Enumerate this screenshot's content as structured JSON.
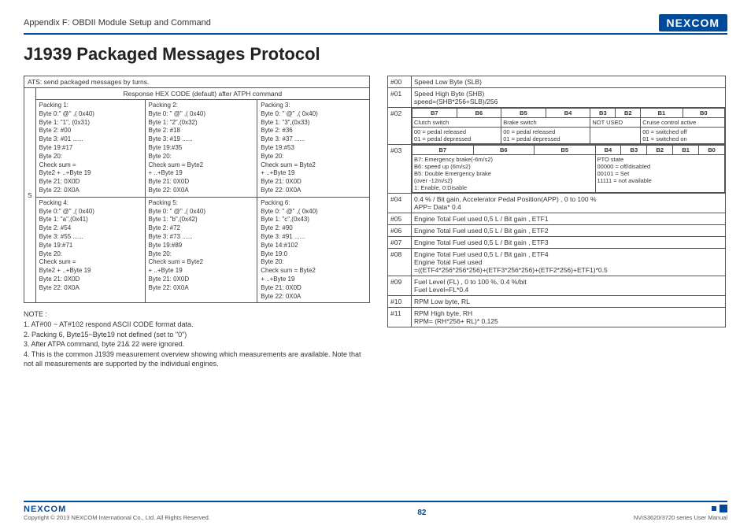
{
  "header": {
    "section": "Appendix F: OBDII Module Setup and Command",
    "logo": "NEXCOM"
  },
  "title": "J1939 Packaged Messages Protocol",
  "leftTable": {
    "atsHeader": "ATS: send packaged messages by turns.",
    "responseHeader": "Response HEX CODE (default) after ATPH command",
    "sLabel": "S",
    "packings": [
      "Packing 1:\nByte 0:\" @\" ,( 0x40)\nByte 1: \"1\", (0x31)\nByte 2: #00\nByte 3: #01 ......\nByte 19:#17\nByte 20:\nCheck sum =\nByte2 + ..+Byte 19\nByte 21: 0X0D\nByte 22: 0X0A",
      "Packing 2:\nByte 0: \" @\" ,( 0x40)\nByte 1: \"2\",(0x32)\nByte 2: #18\nByte 3: #19 ......\nByte 19:#35\nByte 20:\nCheck sum = Byte2\n+ ..+Byte 19\nByte 21: 0X0D\nByte 22: 0X0A",
      "Packing 3:\nByte 0: \" @\" ,( 0x40)\nByte 1: \"3\",(0x33)\nByte 2: #36\nByte 3: #37 ......\nByte 19:#53\nByte 20:\nCheck sum = Byte2\n+ ..+Byte 19\nByte 21: 0X0D\nByte 22: 0X0A",
      "Packing 4:\nByte 0:\" @\" ,( 0x40)\nByte 1: \"a\",(0x41)\nByte 2: #54\nByte 3: #55 ......\nByte 19:#71\nByte 20:\nCheck sum =\nByte2 + ..+Byte 19\nByte 21: 0X0D\nByte 22: 0X0A",
      "Packing 5:\nByte 0: \" @\" ,( 0x40)\nByte 1: \"b\",(0x42)\nByte 2: #72\nByte 3: #73 ......\nByte 19:#89\nByte 20:\nCheck sum = Byte2\n+ ..+Byte 19\nByte 21: 0X0D\nByte 22: 0X0A",
      "Packing 6:\nByte 0: \" @\" ,( 0x40)\nByte 1: \"c\",(0x43)\nByte 2: #90\nByte 3: #91 ......\nByte 14:#102\nByte 19:0\nByte 20:\nCheck sum = Byte2\n+ ..+Byte 19\nByte 21: 0X0D\nByte 22: 0X0A"
    ]
  },
  "notes": {
    "heading": "NOTE :",
    "n1": "1. AT#00 ~ AT#102 respond ASCII CODE format data.",
    "n2": "2. Packing 6, Byte15~Byte19 not defined (set to \"0\")",
    "n3": "3. After ATPA command, byte 21& 22 were ignored.",
    "n4": "4. This is the common J1939 measurement overview showing which measurements are available. Note that not all measurements are supported by the individual engines."
  },
  "right": {
    "r00": {
      "id": "#00",
      "text": "Speed Low Byte (SLB)"
    },
    "r01": {
      "id": "#01",
      "text": "Speed High Byte (SHB)\nspeed=(SHB*256+SLB)/256"
    },
    "r02": {
      "id": "#02",
      "bits": [
        "B7",
        "B6",
        "B5",
        "B4",
        "B3",
        "B2",
        "B1",
        "B0"
      ],
      "c1": "Clutch switch",
      "c2": "Brake switch",
      "c3": "NOT USED",
      "c4": "Cruise control active",
      "d1": "00 = pedal released\n01 = pedal depressed",
      "d2": "00 = pedal released\n01 = pedal depressed",
      "d3": "",
      "d4": "00 = switched off\n01 = switched on"
    },
    "r03": {
      "id": "#03",
      "bits": [
        "B7",
        "B6",
        "B5",
        "B4",
        "B3",
        "B2",
        "B1",
        "B0"
      ],
      "left": "B7: Emergency brake(-6m/s2)\nB6: speed up (6m/s2)\nB5: Double Emergency brake\n(over -12m/s2)\n1: Enable, 0:Disable",
      "right": "PTO state\n00000 = off/disabled\n00101 = Set\n11111 = not available"
    },
    "r04": {
      "id": "#04",
      "text": "0.4 % / Bit gain, Accelerator Pedal Position(APP) , 0 to 100 %\nAPP= Data* 0.4"
    },
    "r05": {
      "id": "#05",
      "text": "Engine Total Fuel used 0,5 L / Bit gain , ETF1"
    },
    "r06": {
      "id": "#06",
      "text": "Engine Total Fuel used 0,5 L / Bit gain , ETF2"
    },
    "r07": {
      "id": "#07",
      "text": "Engine Total Fuel used 0,5 L / Bit gain , ETF3"
    },
    "r08": {
      "id": "#08",
      "text": "Engine Total Fuel used 0,5 L / Bit gain , ETF4\nEngine Total Fuel used\n=((ETF4*256*256*256)+(ETF3*256*256)+(ETF2*256)+ETF1)*0.5"
    },
    "r09": {
      "id": "#09",
      "text": "Fuel Level (FL) , 0 to 100 %, 0.4 %/bit\nFuel Level=FL*0.4"
    },
    "r10": {
      "id": "#10",
      "text": "RPM Low byte, RL"
    },
    "r11": {
      "id": "#11",
      "text": "RPM High byte, RH\nRPM= (RH*256+ RL)* 0.125"
    }
  },
  "footer": {
    "logo": "NEXCOM",
    "copyright": "Copyright © 2013 NEXCOM International Co., Ltd. All Rights Reserved.",
    "page": "82",
    "manual": "NViS3620/3720 series User Manual"
  }
}
